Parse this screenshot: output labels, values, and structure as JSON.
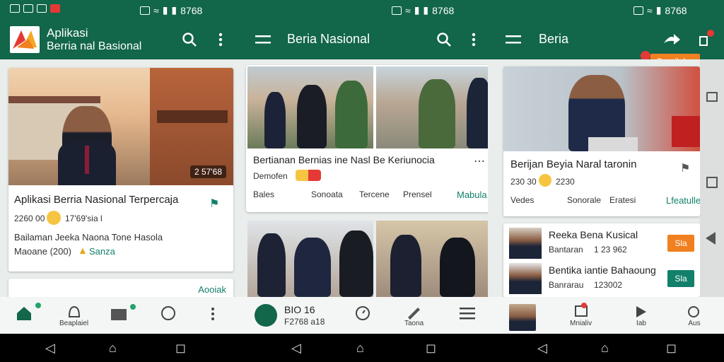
{
  "status": {
    "panel1": {
      "time": "8768"
    },
    "panel2": {
      "time": "8768"
    },
    "panel3": {
      "time": "8768"
    }
  },
  "panel1": {
    "app_title_line1": "Aplikasi",
    "app_title_line2": "Berria nal Basional",
    "card1": {
      "counter": "2 57'68",
      "title": "Aplikasi Berria Nasional Terpercaja",
      "meta_num": "2260 00",
      "meta_text": "17'69'sia l",
      "line1": "Bailaman Jeeka Naona Tone Hasola",
      "line2": "Maoane (200)",
      "line2b": "Sanza"
    },
    "card2": {
      "link": "Aooiak"
    },
    "nav": {
      "item2": "Beaplaiel"
    }
  },
  "panel2": {
    "app_title": "Beria Nasional",
    "card1": {
      "title": "Bertianan Bernias ine Nasl Be Keriunocia",
      "sub": "Demofen",
      "tab1": "Bales",
      "tab2": "Sonoata",
      "tab3": "Tercene",
      "tab4": "Prensel",
      "link": "Mabula"
    },
    "nav": {
      "item1_line1": "BIO 16",
      "item1_line2": "F2768 a18",
      "item3": "Taona"
    }
  },
  "panel3": {
    "app_title": "Beria",
    "badge_label": "Beecihdsn",
    "card1": {
      "title": "Berijan Beyia Naral taronin",
      "meta": "230 30",
      "meta2": "2230",
      "tab1": "Vedes",
      "tab2": "Sonorale",
      "tab3": "Eratesi",
      "link": "Lfeatulle"
    },
    "list": [
      {
        "title": "Reeka Bena Kusical",
        "sub": "Bantaran",
        "sub2": "1 23 962",
        "button": "Sla"
      },
      {
        "title": "Bentika iantie Bahaoung",
        "sub": "Banrarau",
        "sub2": "123002",
        "button": "Sla"
      }
    ],
    "nav": {
      "item2": "Mnialiv",
      "item3": "Iab",
      "item4": "Aus"
    }
  },
  "colors": {
    "brand": "#12664a",
    "accent": "#12806a",
    "orange": "#f08020"
  }
}
